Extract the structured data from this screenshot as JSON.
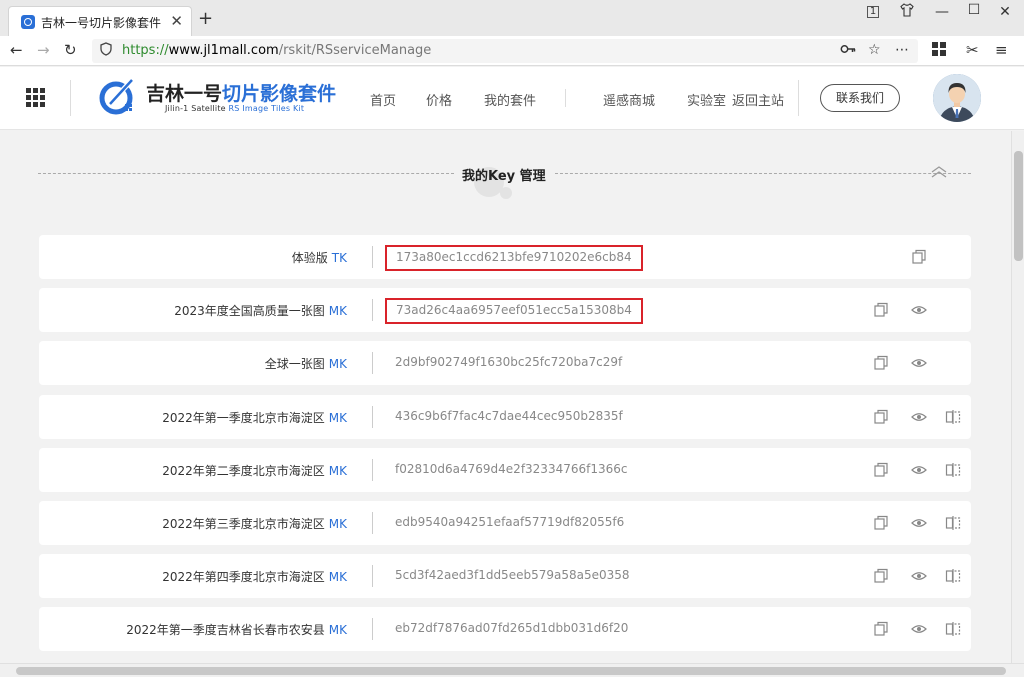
{
  "browser": {
    "tab_title": "吉林一号切片影像套件",
    "url_scheme": "https://",
    "url_domain": "www.jl1mall.com",
    "url_path": "/rskit/RSserviceManage",
    "window_badge": "1"
  },
  "site": {
    "logo_title_black": "吉林一号",
    "logo_title_blue": "切片影像套件",
    "logo_sub_black": "Jilin-1  Satellite ",
    "logo_sub_blue": "RS Image Tiles Kit",
    "nav": [
      "首页",
      "价格",
      "我的套件",
      "遥感商城",
      "实验室",
      "返回主站"
    ],
    "contact_label": "联系我们"
  },
  "section": {
    "title": "我的Key 管理"
  },
  "keys": [
    {
      "name": "体验版",
      "type": "TK",
      "key": "173a80ec1ccd6213bfe9710202e6cb84",
      "highlighted": true,
      "icons": [
        "copy-icon"
      ]
    },
    {
      "name": "2023年度全国高质量一张图",
      "type": "MK",
      "key": "73ad26c4aa6957eef051ecc5a15308b4",
      "highlighted": true,
      "icons": [
        "copy-icon",
        "eye-icon"
      ]
    },
    {
      "name": "全球一张图",
      "type": "MK",
      "key": "2d9bf902749f1630bc25fc720ba7c29f",
      "highlighted": false,
      "icons": [
        "copy-icon",
        "eye-icon"
      ]
    },
    {
      "name": "2022年第一季度北京市海淀区",
      "type": "MK",
      "key": "436c9b6f7fac4c7dae44cec950b2835f",
      "highlighted": false,
      "icons": [
        "copy-icon",
        "eye-icon",
        "compare-icon"
      ]
    },
    {
      "name": "2022年第二季度北京市海淀区",
      "type": "MK",
      "key": "f02810d6a4769d4e2f32334766f1366c",
      "highlighted": false,
      "icons": [
        "copy-icon",
        "eye-icon",
        "compare-icon"
      ]
    },
    {
      "name": "2022年第三季度北京市海淀区",
      "type": "MK",
      "key": "edb9540a94251efaaf57719df82055f6",
      "highlighted": false,
      "icons": [
        "copy-icon",
        "eye-icon",
        "compare-icon"
      ]
    },
    {
      "name": "2022年第四季度北京市海淀区",
      "type": "MK",
      "key": "5cd3f42aed3f1dd5eeb579a58a5e0358",
      "highlighted": false,
      "icons": [
        "copy-icon",
        "eye-icon",
        "compare-icon"
      ]
    },
    {
      "name": "2022年第一季度吉林省长春市农安县",
      "type": "MK",
      "key": "eb72df7876ad07fd265d1dbb031d6f20",
      "highlighted": false,
      "icons": [
        "copy-icon",
        "eye-icon",
        "compare-icon"
      ]
    }
  ],
  "colors": {
    "accent": "#2a6fd6",
    "highlight": "#d9232a",
    "key_text": "#888888"
  }
}
